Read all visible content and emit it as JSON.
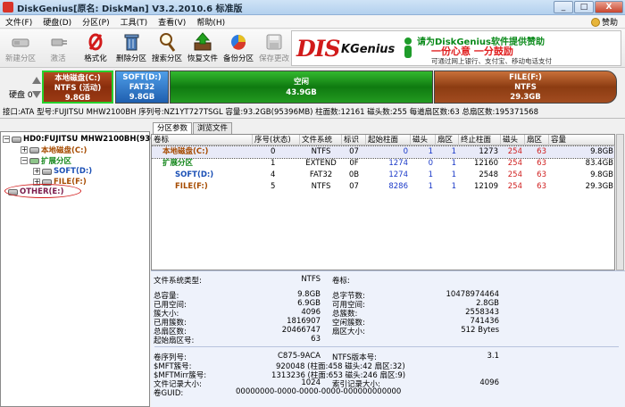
{
  "window": {
    "title": "DiskGenius[原名: DiskMan] V3.2.2010.6 标准版",
    "controls": [
      "_",
      "□",
      "X"
    ]
  },
  "menu": {
    "items": [
      "文件(F)",
      "硬盘(D)",
      "分区(P)",
      "工具(T)",
      "查看(V)",
      "帮助(H)"
    ],
    "sponsor": "赞助"
  },
  "toolbar": {
    "buttons": [
      {
        "label": "新建分区",
        "enabled": false
      },
      {
        "label": "激活",
        "enabled": false
      },
      {
        "label": "格式化",
        "enabled": true
      },
      {
        "label": "删除分区",
        "enabled": true
      },
      {
        "label": "搜索分区",
        "enabled": true
      },
      {
        "label": "恢复文件",
        "enabled": true
      },
      {
        "label": "备份分区",
        "enabled": true
      },
      {
        "label": "保存更改",
        "enabled": false
      }
    ]
  },
  "banner": {
    "logo_main": "DIS",
    "logo_sub": "KGenius",
    "line1": "请为DiskGenius软件提供赞助",
    "line2": "一份心意 一分鼓励",
    "line3": "可通过网上银行、支付宝、移动电话支付"
  },
  "diskbar": {
    "disk_label": "硬盘 0",
    "partitions": [
      {
        "name": "本地磁盘(C:)",
        "fs": "NTFS (活动)",
        "size": "9.8GB"
      },
      {
        "name": "SOFT(D:)",
        "fs": "FAT32",
        "size": "9.8GB"
      },
      {
        "name": "空闲",
        "fs": "",
        "size": "43.9GB"
      },
      {
        "name": "FILE(F:)",
        "fs": "NTFS",
        "size": "29.3GB"
      }
    ]
  },
  "infobar": "接口:ATA  型号:FUJITSU MHW2100BH  序列号:NZ1YT727TSGL  容量:93.2GB(95396MB)  柱面数:12161  磁头数:255  每道扇区数:63  总扇区数:195371568",
  "tree": {
    "disk": "HD0:FUJITSU MHW2100BH(93G)",
    "c": "本地磁盘(C:)",
    "ext": "扩展分区",
    "d": "SOFT(D:)",
    "f": "FILE(F:)",
    "other": "OTHER(E:)"
  },
  "tabs": [
    "分区参数",
    "浏览文件"
  ],
  "grid": {
    "columns": [
      "卷标",
      "序号(状态)",
      "文件系统",
      "标识",
      "起始柱面",
      "磁头",
      "扇区",
      "终止柱面",
      "磁头",
      "扇区",
      "容量"
    ],
    "rows": [
      {
        "label": "本地磁盘(C:)",
        "idx": "0",
        "fs": "NTFS",
        "id": "07",
        "sc": "0",
        "sh": "1",
        "ss": "1",
        "ec": "1273",
        "eh": "254",
        "es": "63",
        "cap": "9.8GB"
      },
      {
        "label": "扩展分区",
        "idx": "1",
        "fs": "EXTEND",
        "id": "0F",
        "sc": "1274",
        "sh": "0",
        "ss": "1",
        "ec": "12160",
        "eh": "254",
        "es": "63",
        "cap": "83.4GB"
      },
      {
        "label": "SOFT(D:)",
        "idx": "4",
        "fs": "FAT32",
        "id": "0B",
        "sc": "1274",
        "sh": "1",
        "ss": "1",
        "ec": "2548",
        "eh": "254",
        "es": "63",
        "cap": "9.8GB"
      },
      {
        "label": "FILE(F:)",
        "idx": "5",
        "fs": "NTFS",
        "id": "07",
        "sc": "8286",
        "sh": "1",
        "ss": "1",
        "ec": "12109",
        "eh": "254",
        "es": "63",
        "cap": "29.3GB"
      }
    ]
  },
  "details": {
    "fs_type_label": "文件系统类型:",
    "fs_type": "NTFS",
    "vol_label": "卷标:",
    "vol_value": "",
    "left": [
      {
        "k": "总容量:",
        "v": "9.8GB"
      },
      {
        "k": "已用空间:",
        "v": "6.9GB"
      },
      {
        "k": "簇大小:",
        "v": "4096"
      },
      {
        "k": "已用簇数:",
        "v": "1816907"
      },
      {
        "k": "总扇区数:",
        "v": "20466747"
      },
      {
        "k": "起始扇区号:",
        "v": "63"
      }
    ],
    "right": [
      {
        "k": "总字节数:",
        "v": "10478974464"
      },
      {
        "k": "可用空间:",
        "v": "2.8GB"
      },
      {
        "k": "总簇数:",
        "v": "2558343"
      },
      {
        "k": "空闲簇数:",
        "v": "741436"
      },
      {
        "k": "扇区大小:",
        "v": "512 Bytes"
      }
    ],
    "bottom": [
      {
        "k": "卷序列号:",
        "v": "C875-9ACA",
        "k2": "NTFS版本号:",
        "v2": "3.1"
      },
      {
        "k": "$MFT簇号:",
        "v": "920048 (柱面:458 磁头:42 扇区:32)"
      },
      {
        "k": "$MFTMirr簇号:",
        "v": "1313236 (柱面:653 磁头:246 扇区:9)"
      },
      {
        "k": "文件记录大小:",
        "v": "1024",
        "k2": "索引记录大小:",
        "v2": "4096"
      },
      {
        "k": "卷GUID:",
        "v": "00000000-0000-0000-0000-000000000000"
      }
    ]
  },
  "colors": {
    "c_part": "#8a2e0c",
    "d_part": "#1f5faf",
    "free": "#0f7a10",
    "f_part": "#8c3c12",
    "active_border": "#26d02b"
  }
}
